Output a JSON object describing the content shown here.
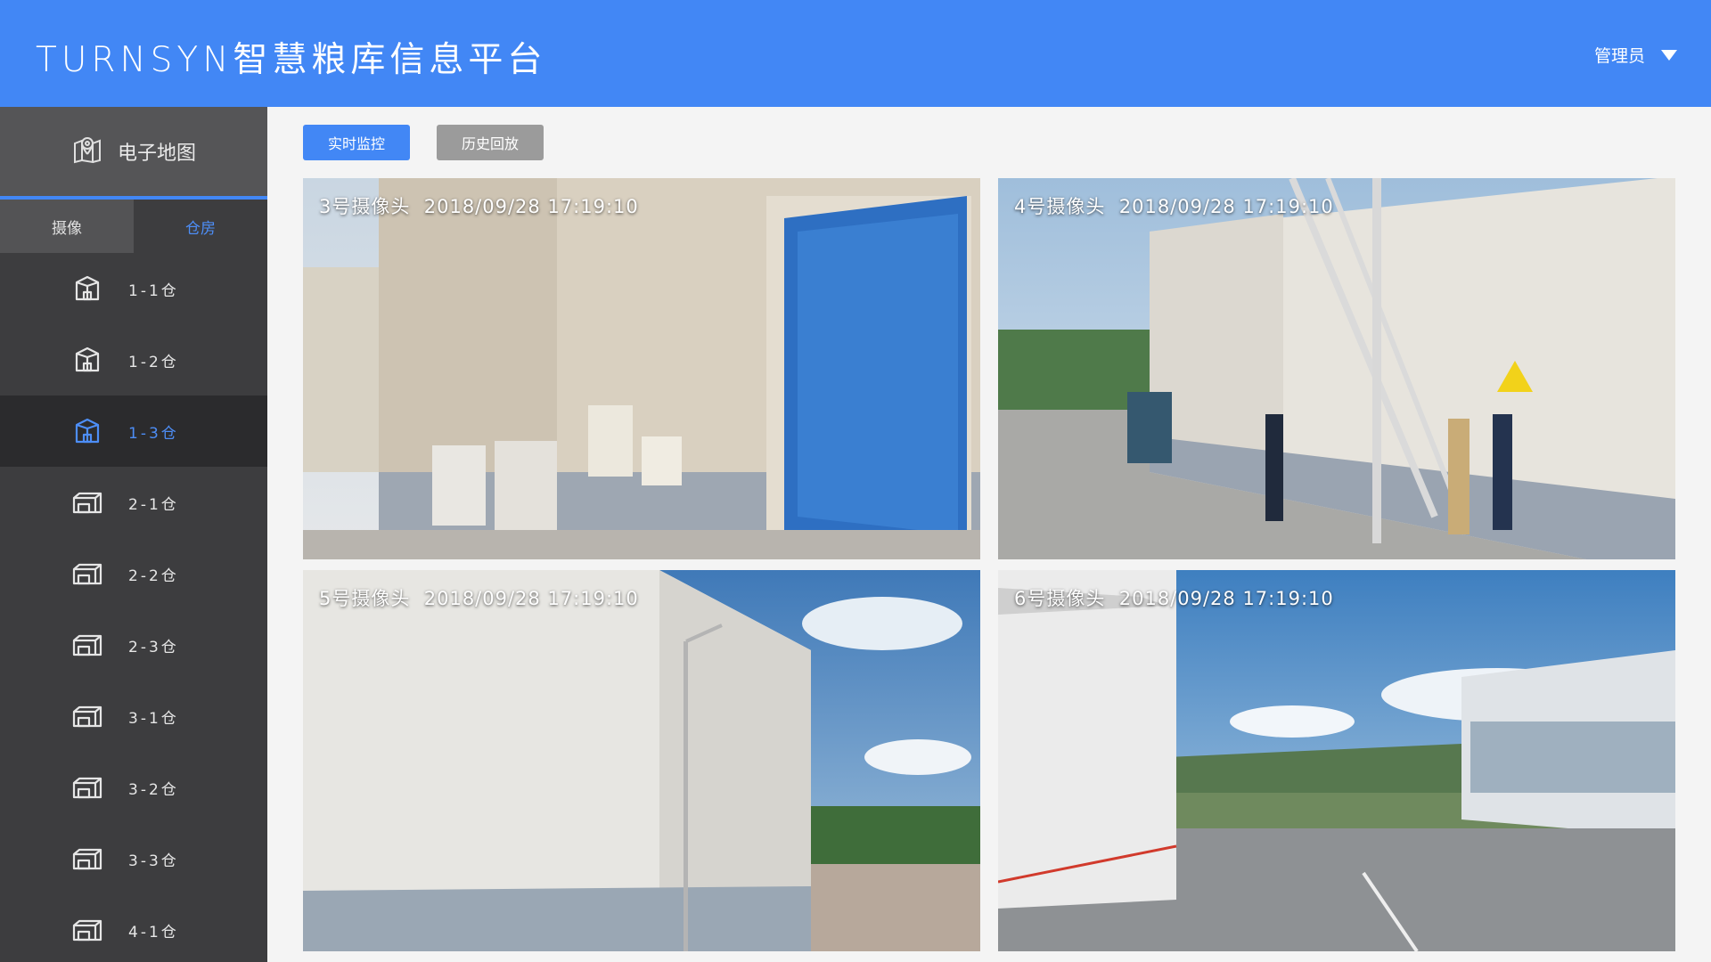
{
  "header": {
    "title": "TURNSYN智慧粮库信息平台",
    "user": "管理员",
    "color": "#4287f5"
  },
  "sidebar": {
    "map_label": "电子地图",
    "tabs": [
      {
        "label": "摄像",
        "active": false
      },
      {
        "label": "仓房",
        "active": true
      }
    ],
    "warehouses": [
      {
        "label": "1-1仓",
        "icon": "warehouse-icon",
        "active": false
      },
      {
        "label": "1-2仓",
        "icon": "warehouse-icon",
        "active": false
      },
      {
        "label": "1-3仓",
        "icon": "warehouse-icon",
        "active": true
      },
      {
        "label": "2-1仓",
        "icon": "warehouse-wide-icon",
        "active": false
      },
      {
        "label": "2-2仓",
        "icon": "warehouse-wide-icon",
        "active": false
      },
      {
        "label": "2-3仓",
        "icon": "warehouse-wide-icon",
        "active": false
      },
      {
        "label": "3-1仓",
        "icon": "warehouse-wide-icon",
        "active": false
      },
      {
        "label": "3-2仓",
        "icon": "warehouse-wide-icon",
        "active": false
      },
      {
        "label": "3-3仓",
        "icon": "warehouse-wide-icon",
        "active": false
      },
      {
        "label": "4-1仓",
        "icon": "warehouse-wide-icon",
        "active": false
      }
    ]
  },
  "toolbar": {
    "live_label": "实时监控",
    "history_label": "历史回放"
  },
  "cameras": [
    {
      "name": "3号摄像头",
      "timestamp": "2018/09/28 17:19:10"
    },
    {
      "name": "4号摄像头",
      "timestamp": "2018/09/28 17:19:10"
    },
    {
      "name": "5号摄像头",
      "timestamp": "2018/09/28 17:19:10"
    },
    {
      "name": "6号摄像头",
      "timestamp": "2018/09/28 17:19:10"
    }
  ]
}
